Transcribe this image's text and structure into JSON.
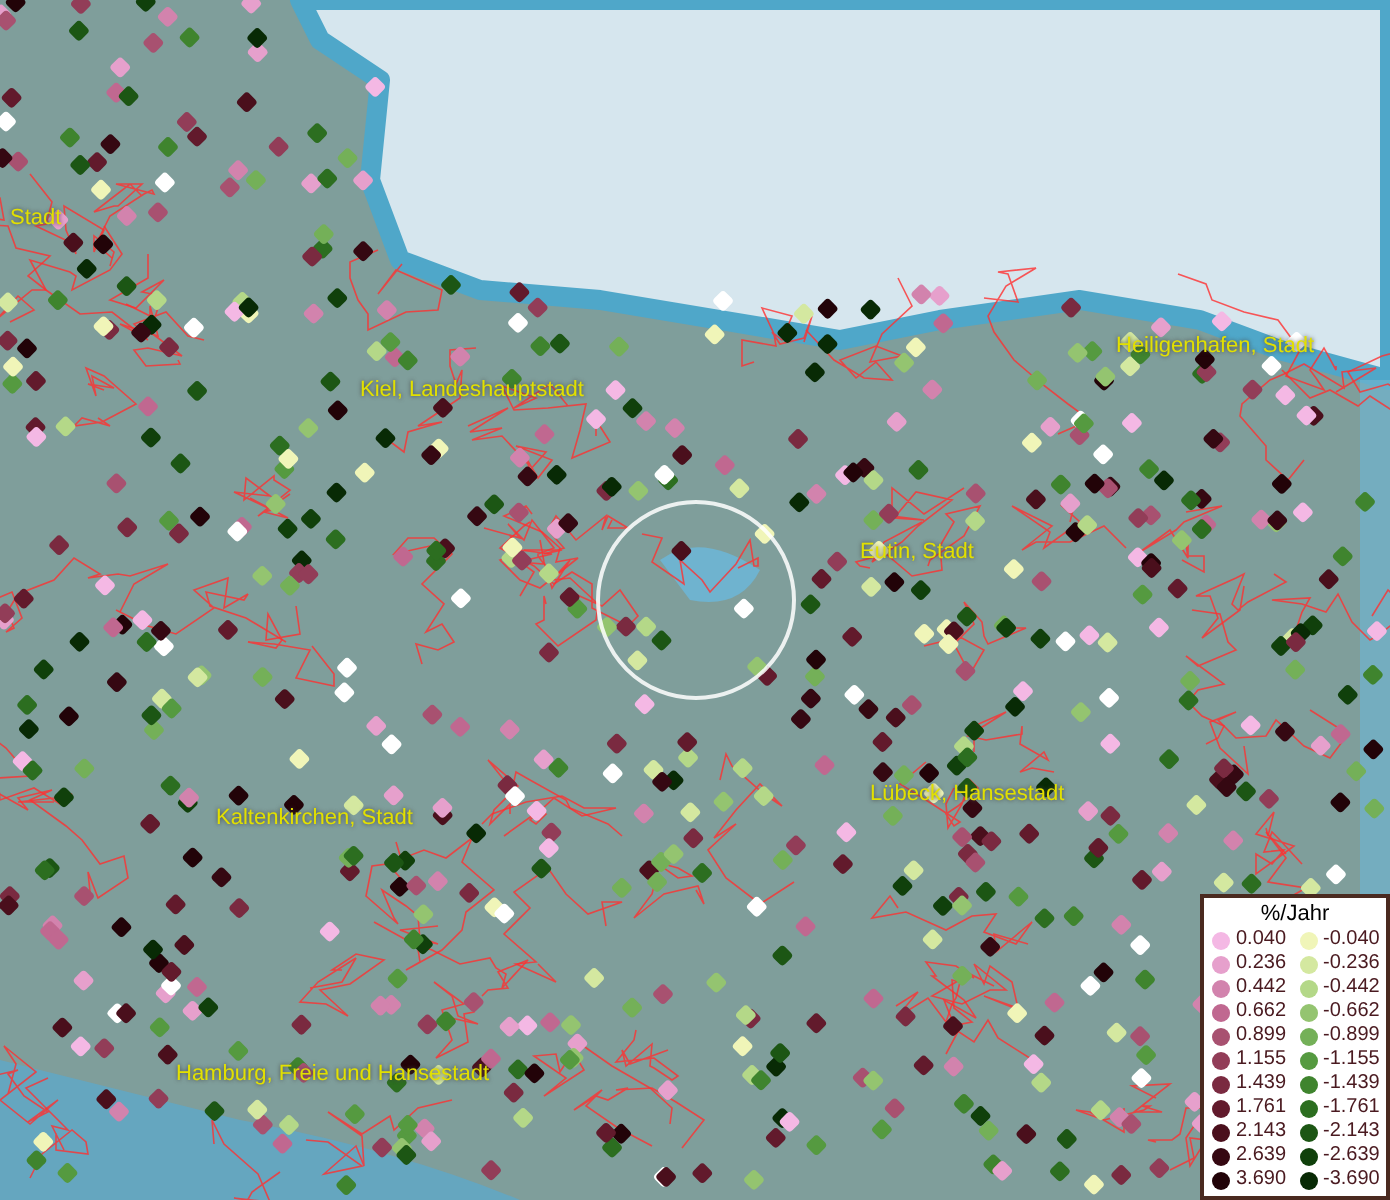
{
  "map_labels": [
    {
      "text": "Stadt"
    },
    {
      "text": "Kiel, Landeshauptstadt"
    },
    {
      "text": "Heiligenhafen, Stadt"
    },
    {
      "text": "Eutin, Stadt"
    },
    {
      "text": "Kaltenkirchen, Stadt"
    },
    {
      "text": "Lübeck, Hansestadt"
    },
    {
      "text": "Hamburg, Freie und Hansestadt"
    }
  ],
  "legend": {
    "title": "%/Jahr",
    "items": [
      {
        "label": "0.040",
        "color": "#f4b8e4"
      },
      {
        "label": "-0.040",
        "color": "#f0f5b8"
      },
      {
        "label": "0.236",
        "color": "#e6a0cc"
      },
      {
        "label": "-0.236",
        "color": "#d4e8a0"
      },
      {
        "label": "0.442",
        "color": "#d283ad"
      },
      {
        "label": "-0.442",
        "color": "#b4d888"
      },
      {
        "label": "0.662",
        "color": "#c06890"
      },
      {
        "label": "-0.662",
        "color": "#94c470"
      },
      {
        "label": "0.899",
        "color": "#a85170"
      },
      {
        "label": "-0.899",
        "color": "#74b058"
      },
      {
        "label": "1.155",
        "color": "#923d58"
      },
      {
        "label": "-1.155",
        "color": "#559a40"
      },
      {
        "label": "1.439",
        "color": "#7a2a40"
      },
      {
        "label": "-1.439",
        "color": "#3f842e"
      },
      {
        "label": "1.761",
        "color": "#621a2c"
      },
      {
        "label": "-1.761",
        "color": "#2c6e20"
      },
      {
        "label": "2.143",
        "color": "#4a0f1c"
      },
      {
        "label": "-2.143",
        "color": "#1c5614"
      },
      {
        "label": "2.639",
        "color": "#350812"
      },
      {
        "label": "-2.639",
        "color": "#10400b"
      },
      {
        "label": "3.690",
        "color": "#220308"
      },
      {
        "label": "-3.690",
        "color": "#082a05"
      }
    ]
  }
}
